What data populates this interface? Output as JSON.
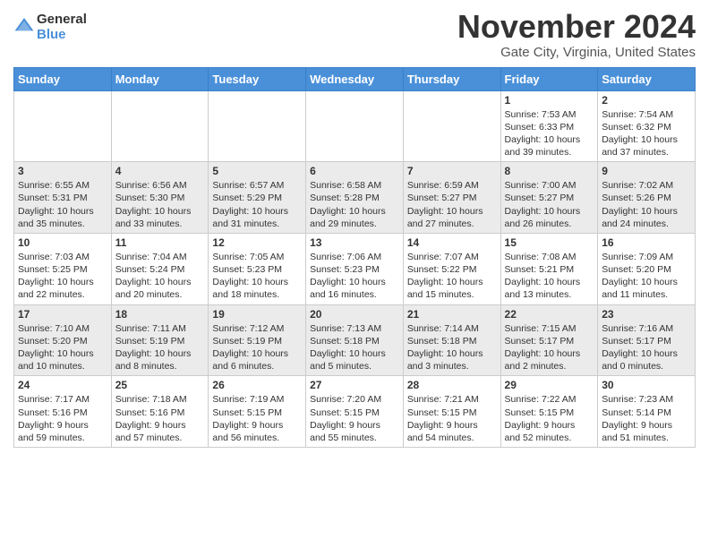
{
  "header": {
    "logo_line1": "General",
    "logo_line2": "Blue",
    "month_title": "November 2024",
    "location": "Gate City, Virginia, United States"
  },
  "weekdays": [
    "Sunday",
    "Monday",
    "Tuesday",
    "Wednesday",
    "Thursday",
    "Friday",
    "Saturday"
  ],
  "weeks": [
    [
      {
        "day": "",
        "info": ""
      },
      {
        "day": "",
        "info": ""
      },
      {
        "day": "",
        "info": ""
      },
      {
        "day": "",
        "info": ""
      },
      {
        "day": "",
        "info": ""
      },
      {
        "day": "1",
        "info": "Sunrise: 7:53 AM\nSunset: 6:33 PM\nDaylight: 10 hours\nand 39 minutes."
      },
      {
        "day": "2",
        "info": "Sunrise: 7:54 AM\nSunset: 6:32 PM\nDaylight: 10 hours\nand 37 minutes."
      }
    ],
    [
      {
        "day": "3",
        "info": "Sunrise: 6:55 AM\nSunset: 5:31 PM\nDaylight: 10 hours\nand 35 minutes."
      },
      {
        "day": "4",
        "info": "Sunrise: 6:56 AM\nSunset: 5:30 PM\nDaylight: 10 hours\nand 33 minutes."
      },
      {
        "day": "5",
        "info": "Sunrise: 6:57 AM\nSunset: 5:29 PM\nDaylight: 10 hours\nand 31 minutes."
      },
      {
        "day": "6",
        "info": "Sunrise: 6:58 AM\nSunset: 5:28 PM\nDaylight: 10 hours\nand 29 minutes."
      },
      {
        "day": "7",
        "info": "Sunrise: 6:59 AM\nSunset: 5:27 PM\nDaylight: 10 hours\nand 27 minutes."
      },
      {
        "day": "8",
        "info": "Sunrise: 7:00 AM\nSunset: 5:27 PM\nDaylight: 10 hours\nand 26 minutes."
      },
      {
        "day": "9",
        "info": "Sunrise: 7:02 AM\nSunset: 5:26 PM\nDaylight: 10 hours\nand 24 minutes."
      }
    ],
    [
      {
        "day": "10",
        "info": "Sunrise: 7:03 AM\nSunset: 5:25 PM\nDaylight: 10 hours\nand 22 minutes."
      },
      {
        "day": "11",
        "info": "Sunrise: 7:04 AM\nSunset: 5:24 PM\nDaylight: 10 hours\nand 20 minutes."
      },
      {
        "day": "12",
        "info": "Sunrise: 7:05 AM\nSunset: 5:23 PM\nDaylight: 10 hours\nand 18 minutes."
      },
      {
        "day": "13",
        "info": "Sunrise: 7:06 AM\nSunset: 5:23 PM\nDaylight: 10 hours\nand 16 minutes."
      },
      {
        "day": "14",
        "info": "Sunrise: 7:07 AM\nSunset: 5:22 PM\nDaylight: 10 hours\nand 15 minutes."
      },
      {
        "day": "15",
        "info": "Sunrise: 7:08 AM\nSunset: 5:21 PM\nDaylight: 10 hours\nand 13 minutes."
      },
      {
        "day": "16",
        "info": "Sunrise: 7:09 AM\nSunset: 5:20 PM\nDaylight: 10 hours\nand 11 minutes."
      }
    ],
    [
      {
        "day": "17",
        "info": "Sunrise: 7:10 AM\nSunset: 5:20 PM\nDaylight: 10 hours\nand 10 minutes."
      },
      {
        "day": "18",
        "info": "Sunrise: 7:11 AM\nSunset: 5:19 PM\nDaylight: 10 hours\nand 8 minutes."
      },
      {
        "day": "19",
        "info": "Sunrise: 7:12 AM\nSunset: 5:19 PM\nDaylight: 10 hours\nand 6 minutes."
      },
      {
        "day": "20",
        "info": "Sunrise: 7:13 AM\nSunset: 5:18 PM\nDaylight: 10 hours\nand 5 minutes."
      },
      {
        "day": "21",
        "info": "Sunrise: 7:14 AM\nSunset: 5:18 PM\nDaylight: 10 hours\nand 3 minutes."
      },
      {
        "day": "22",
        "info": "Sunrise: 7:15 AM\nSunset: 5:17 PM\nDaylight: 10 hours\nand 2 minutes."
      },
      {
        "day": "23",
        "info": "Sunrise: 7:16 AM\nSunset: 5:17 PM\nDaylight: 10 hours\nand 0 minutes."
      }
    ],
    [
      {
        "day": "24",
        "info": "Sunrise: 7:17 AM\nSunset: 5:16 PM\nDaylight: 9 hours\nand 59 minutes."
      },
      {
        "day": "25",
        "info": "Sunrise: 7:18 AM\nSunset: 5:16 PM\nDaylight: 9 hours\nand 57 minutes."
      },
      {
        "day": "26",
        "info": "Sunrise: 7:19 AM\nSunset: 5:15 PM\nDaylight: 9 hours\nand 56 minutes."
      },
      {
        "day": "27",
        "info": "Sunrise: 7:20 AM\nSunset: 5:15 PM\nDaylight: 9 hours\nand 55 minutes."
      },
      {
        "day": "28",
        "info": "Sunrise: 7:21 AM\nSunset: 5:15 PM\nDaylight: 9 hours\nand 54 minutes."
      },
      {
        "day": "29",
        "info": "Sunrise: 7:22 AM\nSunset: 5:15 PM\nDaylight: 9 hours\nand 52 minutes."
      },
      {
        "day": "30",
        "info": "Sunrise: 7:23 AM\nSunset: 5:14 PM\nDaylight: 9 hours\nand 51 minutes."
      }
    ]
  ]
}
